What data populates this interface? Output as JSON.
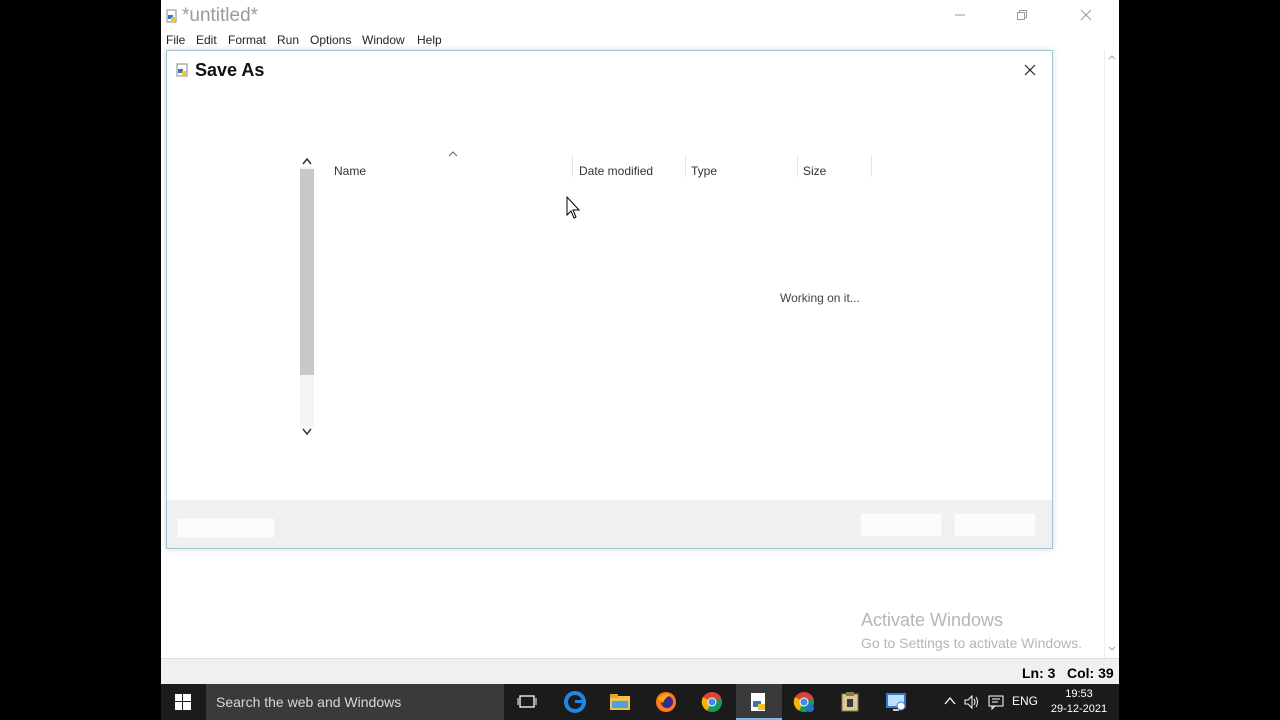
{
  "editor": {
    "title": "*untitled*",
    "menu": [
      "File",
      "Edit",
      "Format",
      "Run",
      "Options",
      "Window",
      "Help"
    ],
    "status": {
      "line": "Ln: 3",
      "col": "Col: 39"
    }
  },
  "dialog": {
    "title": "Save As",
    "columns": [
      "Name",
      "Date modified",
      "Type",
      "Size"
    ],
    "loading_text": "Working on it..."
  },
  "watermark": {
    "line1": "Activate Windows",
    "line2": "Go to Settings to activate Windows."
  },
  "taskbar": {
    "search_placeholder": "Search the web and Windows",
    "language": "ENG",
    "time": "19:53",
    "date": "29-12-2021",
    "icons": [
      "windows-start-icon",
      "task-view-icon",
      "edge-icon",
      "file-explorer-icon",
      "firefox-icon",
      "chrome-icon",
      "idle-icon",
      "chrome-app-icon",
      "archive-icon",
      "remote-icon"
    ]
  }
}
